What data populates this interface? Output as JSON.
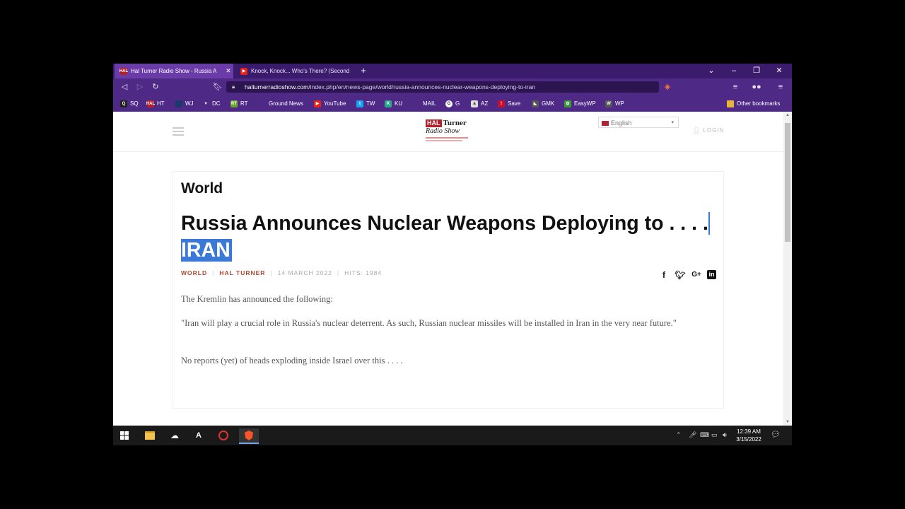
{
  "browser": {
    "tabs": [
      {
        "title": "Hal Turner Radio Show - Russia A",
        "active": true,
        "favicon": "HAL"
      },
      {
        "title": "Knock, Knock... Who's There? (Second",
        "active": false,
        "favicon": "youtube-icon"
      }
    ],
    "new_tab": "+",
    "url": {
      "host": "halturnerradioshow.com",
      "path": "/index.php/en/news-page/world/russia-announces-nuclear-weapons-deploying-to-iran"
    },
    "bookmarks": [
      {
        "label": "SQ",
        "icon": "Q",
        "color": "#222"
      },
      {
        "label": "HT",
        "icon": "HAL",
        "color": "#b4202a"
      },
      {
        "label": "WJ",
        "icon": "",
        "color": "#1b3a6b"
      },
      {
        "label": "DC",
        "icon": "♥",
        "color": "#4e2a86"
      },
      {
        "label": "RT",
        "icon": "RT",
        "color": "#6ba32d"
      },
      {
        "label": "Ground News",
        "icon": "",
        "color": "#4e2a86"
      },
      {
        "label": "YouTube",
        "icon": "▶",
        "color": "#e62117"
      },
      {
        "label": "TW",
        "icon": "t",
        "color": "#1da1f2"
      },
      {
        "label": "KU",
        "icon": "K",
        "color": "#2aa889"
      },
      {
        "label": "MAIL",
        "icon": "",
        "color": "#4e2a86"
      },
      {
        "label": "G",
        "icon": "G",
        "color": "#fff"
      },
      {
        "label": "AZ",
        "icon": "a",
        "color": "#ddd"
      },
      {
        "label": "Save",
        "icon": "!",
        "color": "#c8102e"
      },
      {
        "label": "GMK",
        "icon": "◣",
        "color": "#555"
      },
      {
        "label": "EasyWP",
        "icon": "✿",
        "color": "#3a9a3a"
      },
      {
        "label": "WP",
        "icon": "W",
        "color": "#555"
      }
    ],
    "other_bookmarks": "Other bookmarks"
  },
  "site": {
    "logo_line1": "HAL",
    "logo_line2": "Turner",
    "logo_line3": "Radio Show",
    "language": "English",
    "login": "LOGIN"
  },
  "article": {
    "category": "World",
    "headline": "Russia Announces Nuclear Weapons Deploying to . . . .",
    "headline_highlight": " IRAN",
    "meta": {
      "category": "WORLD",
      "author": "HAL TURNER",
      "date": "14 MARCH 2022",
      "hits": "HITS: 1984"
    },
    "paragraphs": [
      "The Kremlin has announced the following:",
      "\"Iran will play a crucial role in Russia's nuclear deterrent.  As such, Russian nuclear missiles will be installed in Iran in the very near future.\"",
      "No reports (yet) of heads exploding inside Israel over this . . . ."
    ],
    "share_icons": [
      "facebook-icon",
      "twitter-icon",
      "google-plus-icon",
      "linkedin-icon"
    ]
  },
  "taskbar": {
    "time": "12:39 AM",
    "date": "3/15/2022"
  }
}
